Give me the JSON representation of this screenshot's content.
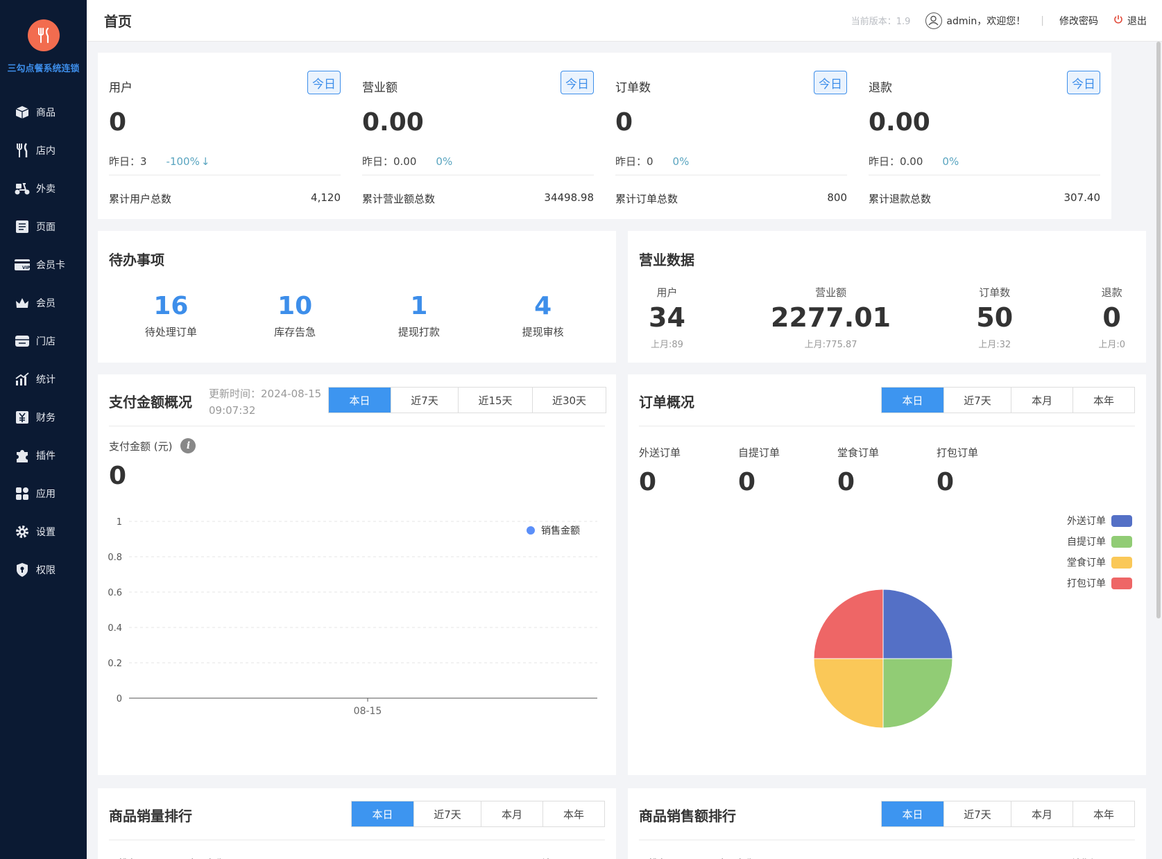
{
  "app": {
    "logo_text": "三勾点餐系统连锁"
  },
  "sidebar": {
    "items": [
      {
        "label": "商品",
        "icon": "box-icon"
      },
      {
        "label": "店内",
        "icon": "cutlery-icon"
      },
      {
        "label": "外卖",
        "icon": "scooter-icon"
      },
      {
        "label": "页面",
        "icon": "page-icon"
      },
      {
        "label": "会员卡",
        "icon": "vip-card-icon"
      },
      {
        "label": "会员",
        "icon": "crown-icon"
      },
      {
        "label": "门店",
        "icon": "store-icon"
      },
      {
        "label": "统计",
        "icon": "chart-icon"
      },
      {
        "label": "财务",
        "icon": "yuan-icon"
      },
      {
        "label": "插件",
        "icon": "puzzle-icon"
      },
      {
        "label": "应用",
        "icon": "apps-icon"
      },
      {
        "label": "设置",
        "icon": "gear-icon"
      },
      {
        "label": "权限",
        "icon": "shield-icon"
      }
    ]
  },
  "header": {
    "title": "首页",
    "version": "当前版本：1.9",
    "welcome": "admin，欢迎您！",
    "separator": "|",
    "change_password": "修改密码",
    "logout": "退出"
  },
  "stats": [
    {
      "label": "用户",
      "badge": "今日",
      "value": "0",
      "yesterday": "昨日：3",
      "pct": "-100%",
      "arrow": "↓",
      "total_label": "累计用户总数",
      "total": "4,120"
    },
    {
      "label": "营业额",
      "badge": "今日",
      "value": "0.00",
      "yesterday": "昨日：0.00",
      "pct": "0%",
      "arrow": "",
      "total_label": "累计营业额总数",
      "total": "34498.98"
    },
    {
      "label": "订单数",
      "badge": "今日",
      "value": "0",
      "yesterday": "昨日：0",
      "pct": "0%",
      "arrow": "",
      "total_label": "累计订单总数",
      "total": "800"
    },
    {
      "label": "退款",
      "badge": "今日",
      "value": "0.00",
      "yesterday": "昨日：0.00",
      "pct": "0%",
      "arrow": "",
      "total_label": "累计退款总数",
      "total": "307.40"
    }
  ],
  "todo": {
    "title": "待办事项",
    "items": [
      {
        "num": "16",
        "label": "待处理订单"
      },
      {
        "num": "10",
        "label": "库存告急"
      },
      {
        "num": "1",
        "label": "提现打款"
      },
      {
        "num": "4",
        "label": "提现审核"
      }
    ]
  },
  "business": {
    "title": "营业数据",
    "items": [
      {
        "label": "用户",
        "num": "34",
        "last": "上月:89"
      },
      {
        "label": "营业额",
        "num": "2277.01",
        "last": "上月:775.87"
      },
      {
        "label": "订单数",
        "num": "50",
        "last": "上月:32"
      },
      {
        "label": "退款",
        "num": "0",
        "last": "上月:0"
      }
    ]
  },
  "payment": {
    "title": "支付金额概况",
    "update_time_line1": "更新时间：2024-08-15",
    "update_time_line2": "09:07:32",
    "tabs": [
      "本日",
      "近7天",
      "近15天",
      "近30天"
    ],
    "active_tab": 0,
    "amount_label": "支付金额 (元)",
    "info_glyph": "i",
    "amount": "0"
  },
  "orders": {
    "title": "订单概况",
    "tabs": [
      "本日",
      "近7天",
      "本月",
      "本年"
    ],
    "active_tab": 0,
    "types": [
      {
        "label": "外送订单",
        "num": "0"
      },
      {
        "label": "自提订单",
        "num": "0"
      },
      {
        "label": "堂食订单",
        "num": "0"
      },
      {
        "label": "打包订单",
        "num": "0"
      }
    ]
  },
  "ranking_qty": {
    "title": "商品销量排行",
    "tabs": [
      "本日",
      "近7天",
      "本月",
      "本年"
    ],
    "columns": [
      "排名",
      "商品名称",
      "销量"
    ]
  },
  "ranking_amount": {
    "title": "商品销售额排行",
    "tabs": [
      "本日",
      "近7天",
      "本月",
      "本年"
    ],
    "columns": [
      "排名",
      "商品名称",
      "销售额"
    ]
  },
  "colors": {
    "accent": "#3d95f0",
    "sidebar": "#0b1a33",
    "logo": "#f26c4f"
  },
  "chart_data": [
    {
      "type": "line",
      "categories": [
        "08-15"
      ],
      "series": [
        {
          "name": "销售金额",
          "values": [
            0
          ],
          "color": "#5b8ff9"
        }
      ],
      "ylim": [
        0,
        1
      ],
      "yticks": [
        "0",
        "0.2",
        "0.4",
        "0.6",
        "0.8",
        "1"
      ],
      "grid": true,
      "legend": "top-right"
    },
    {
      "type": "pie",
      "slices": [
        {
          "name": "外送订单",
          "value": 1,
          "color": "#5470c6"
        },
        {
          "name": "自提订单",
          "value": 1,
          "color": "#91cc75"
        },
        {
          "name": "堂食订单",
          "value": 1,
          "color": "#fac858"
        },
        {
          "name": "打包订单",
          "value": 1,
          "color": "#ee6666"
        }
      ],
      "legend": "top-right"
    }
  ]
}
